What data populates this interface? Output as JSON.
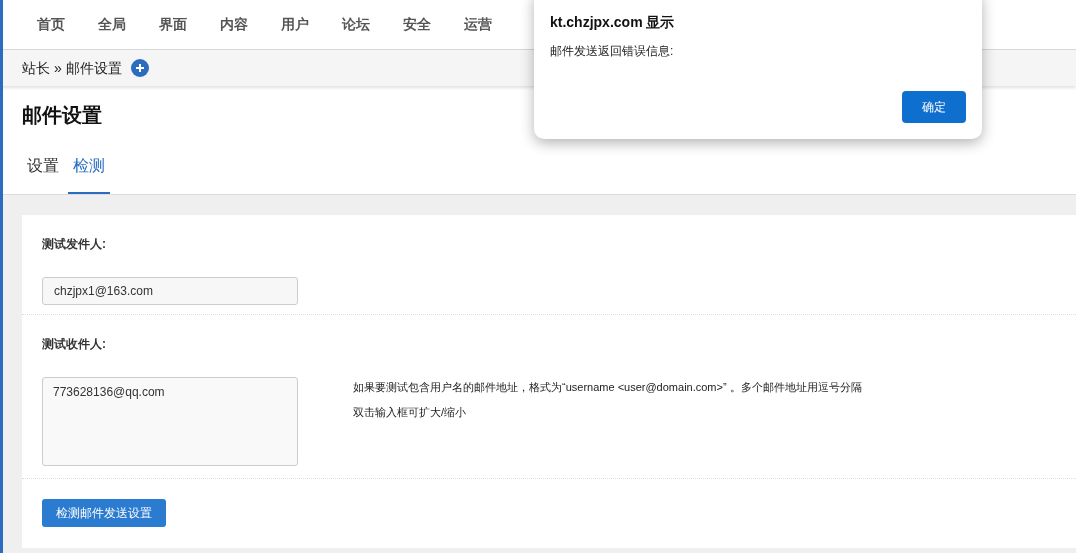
{
  "nav": {
    "items": [
      {
        "label": "首页",
        "selected": false
      },
      {
        "label": "全局",
        "selected": false
      },
      {
        "label": "界面",
        "selected": false
      },
      {
        "label": "内容",
        "selected": false
      },
      {
        "label": "用户",
        "selected": false
      },
      {
        "label": "论坛",
        "selected": false
      },
      {
        "label": "安全",
        "selected": false
      },
      {
        "label": "运营",
        "selected": false
      }
    ]
  },
  "breadcrumb": {
    "root": "站长",
    "separator": "»",
    "current": "邮件设置"
  },
  "page_title": "邮件设置",
  "tabs": [
    {
      "label": "设置",
      "selected": false
    },
    {
      "label": "检测",
      "selected": true
    }
  ],
  "form": {
    "sender_label": "测试发件人:",
    "sender_value": "chzjpx1@163.com",
    "recipient_label": "测试收件人:",
    "recipient_value": "773628136@qq.com",
    "hints": [
      "如果要测试包含用户名的邮件地址，格式为“username <user@domain.com>” 。多个邮件地址用逗号分隔",
      "双击输入框可扩大/缩小"
    ],
    "submit": "检测邮件发送设置"
  },
  "dialog": {
    "title": "kt.chzjpx.com 显示",
    "message": "邮件发送返回错误信息:",
    "button": "确定"
  }
}
